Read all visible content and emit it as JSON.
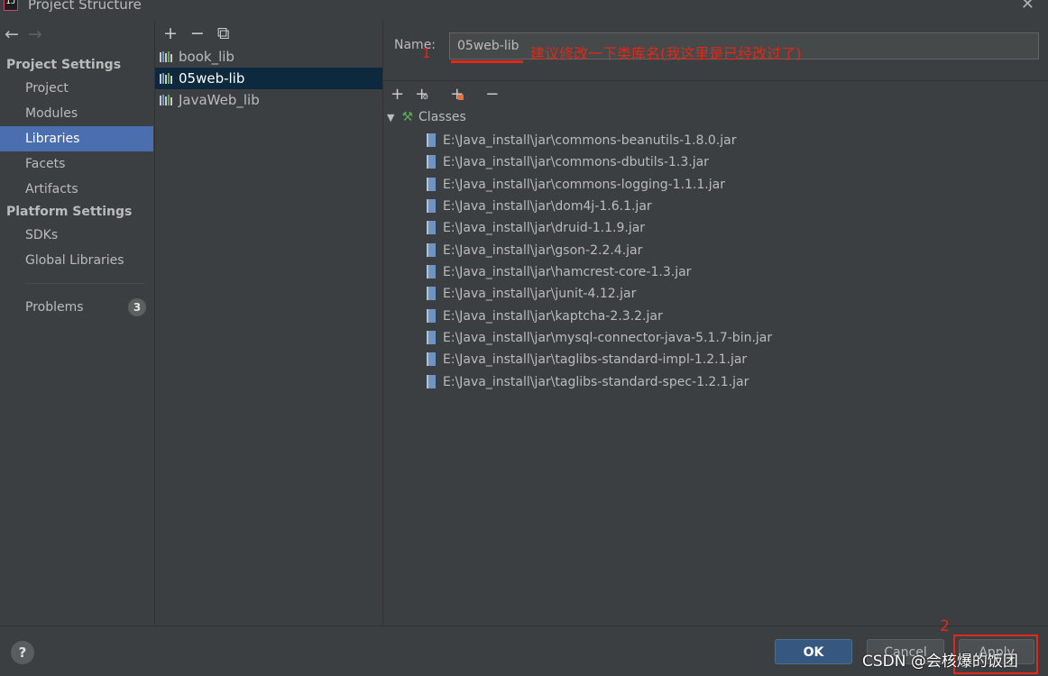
{
  "window": {
    "title": "Project Structure",
    "app_icon_text": "IJ",
    "close_glyph": "✕"
  },
  "nav": {
    "back_glyph": "←",
    "forward_glyph": "→",
    "project_settings_header": "Project Settings",
    "project_settings_items": [
      "Project",
      "Modules",
      "Libraries",
      "Facets",
      "Artifacts"
    ],
    "platform_settings_header": "Platform Settings",
    "platform_settings_items": [
      "SDKs",
      "Global Libraries"
    ],
    "problems_label": "Problems",
    "problems_count": "3",
    "selected_item": "Libraries"
  },
  "libraries": {
    "toolbar": {
      "add": "+",
      "remove": "−",
      "copy": "⧉"
    },
    "items": [
      "book_lib",
      "05web-lib",
      "JavaWeb_lib"
    ],
    "selected": "05web-lib"
  },
  "detail": {
    "name_label": "Name:",
    "name_value": "05web-lib",
    "annotation_num": "1",
    "annotation_text": "建议修改一下类库名(我这里是已经改过了)",
    "toolbar": {
      "add": "+",
      "add_alt": "+",
      "add_jar": "+",
      "remove": "−"
    },
    "classes_label": "Classes",
    "class_paths": [
      "E:\\Java_install\\jar\\commons-beanutils-1.8.0.jar",
      "E:\\Java_install\\jar\\commons-dbutils-1.3.jar",
      "E:\\Java_install\\jar\\commons-logging-1.1.1.jar",
      "E:\\Java_install\\jar\\dom4j-1.6.1.jar",
      "E:\\Java_install\\jar\\druid-1.1.9.jar",
      "E:\\Java_install\\jar\\gson-2.2.4.jar",
      "E:\\Java_install\\jar\\hamcrest-core-1.3.jar",
      "E:\\Java_install\\jar\\junit-4.12.jar",
      "E:\\Java_install\\jar\\kaptcha-2.3.2.jar",
      "E:\\Java_install\\jar\\mysql-connector-java-5.1.7-bin.jar",
      "E:\\Java_install\\jar\\taglibs-standard-impl-1.2.1.jar",
      "E:\\Java_install\\jar\\taglibs-standard-spec-1.2.1.jar"
    ]
  },
  "footer": {
    "help": "?",
    "ok": "OK",
    "cancel": "Cancel",
    "apply": "Apply",
    "annotation_num": "2",
    "watermark": "CSDN @会核爆的饭团"
  },
  "colors": {
    "accent": "#4b6eaf",
    "annotation": "#e0291a",
    "selected_lib": "#0d293e",
    "ok_button": "#365880"
  }
}
